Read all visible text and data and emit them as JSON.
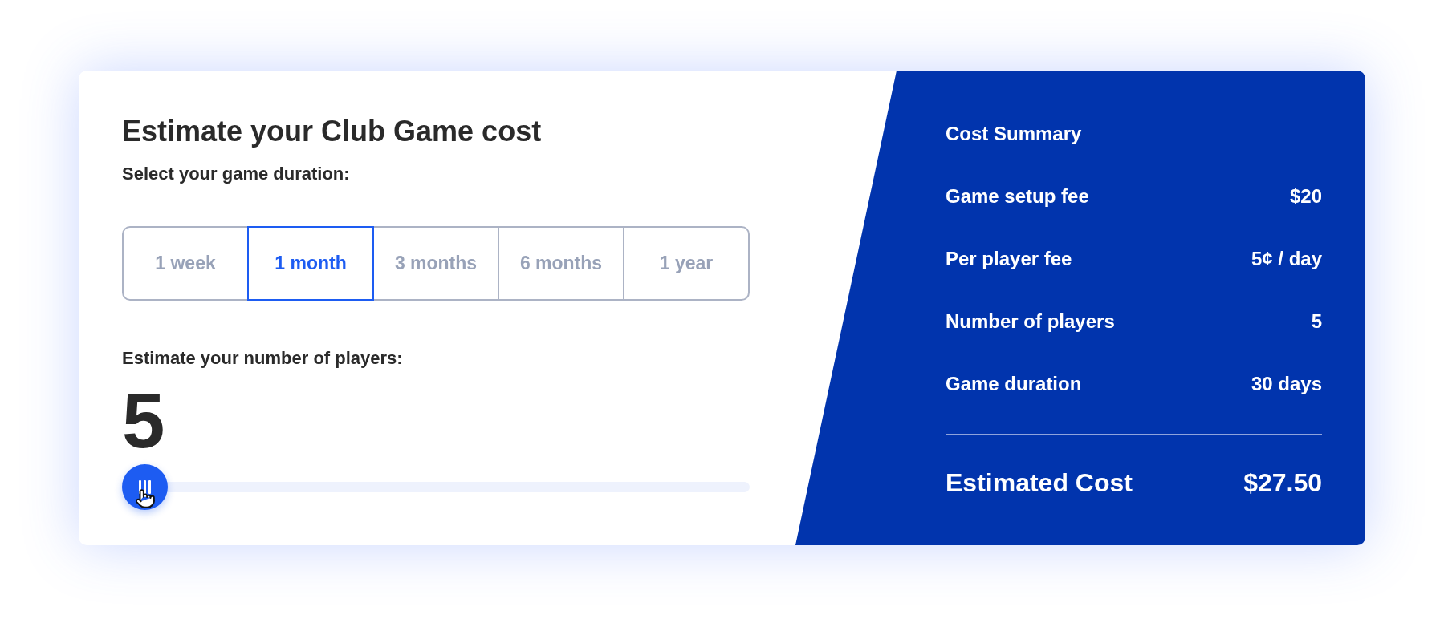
{
  "calculator": {
    "title": "Estimate your Club Game cost",
    "duration": {
      "label": "Select your game duration:",
      "options": [
        {
          "label": "1 week",
          "selected": false
        },
        {
          "label": "1 month",
          "selected": true
        },
        {
          "label": "3 months",
          "selected": false
        },
        {
          "label": "6 months",
          "selected": false
        },
        {
          "label": "1 year",
          "selected": false
        }
      ]
    },
    "players": {
      "label": "Estimate your number of players:",
      "value": "5",
      "slider": {
        "level": 0
      }
    }
  },
  "summary": {
    "title": "Cost Summary",
    "rows": [
      {
        "label": "Game setup fee",
        "value": "$20"
      },
      {
        "label": "Per player fee",
        "value": "5¢ / day"
      },
      {
        "label": "Number of players",
        "value": "5"
      },
      {
        "label": "Game duration",
        "value": "30 days"
      }
    ],
    "total": {
      "label": "Estimated Cost",
      "value": "$27.50"
    }
  }
}
